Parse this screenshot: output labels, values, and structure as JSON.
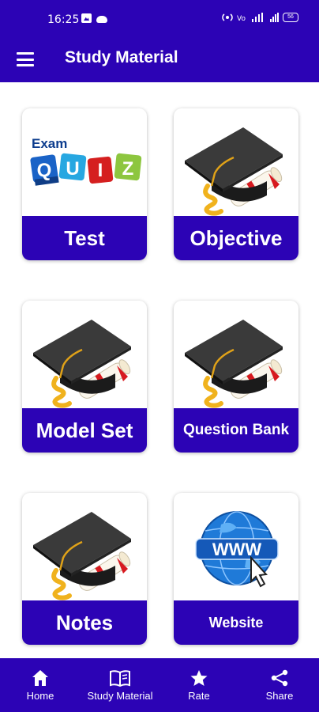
{
  "status_bar": {
    "time": "16:25",
    "battery": "56",
    "icons": [
      "gallery-icon",
      "cloud-icon",
      "hotspot-icon",
      "volte-icon",
      "wifi-signal-icon",
      "signal-icon",
      "battery-icon"
    ]
  },
  "app_bar": {
    "title": "Study Material",
    "menu_icon": "menu-icon"
  },
  "cards": [
    {
      "label": "Test",
      "icon": "exam-quiz-blocks"
    },
    {
      "label": "Objective",
      "icon": "graduation-cap"
    },
    {
      "label": "Model Set",
      "icon": "graduation-cap"
    },
    {
      "label": "Question Bank",
      "icon": "graduation-cap"
    },
    {
      "label": "Notes",
      "icon": "graduation-cap"
    },
    {
      "label": "Website",
      "icon": "www-globe"
    }
  ],
  "quiz_art": {
    "exam": "Exam",
    "letters": [
      "Q",
      "U",
      "I",
      "Z"
    ]
  },
  "website_art": {
    "text": "WWW"
  },
  "colors": {
    "primary": "#2c03b5",
    "card_bg": "#ffffff",
    "text_on_primary": "#ffffff"
  },
  "bottom_nav": [
    {
      "label": "Home",
      "icon": "home-icon"
    },
    {
      "label": "Study Material",
      "icon": "book-icon"
    },
    {
      "label": "Rate",
      "icon": "star-icon"
    },
    {
      "label": "Share",
      "icon": "share-icon"
    }
  ]
}
